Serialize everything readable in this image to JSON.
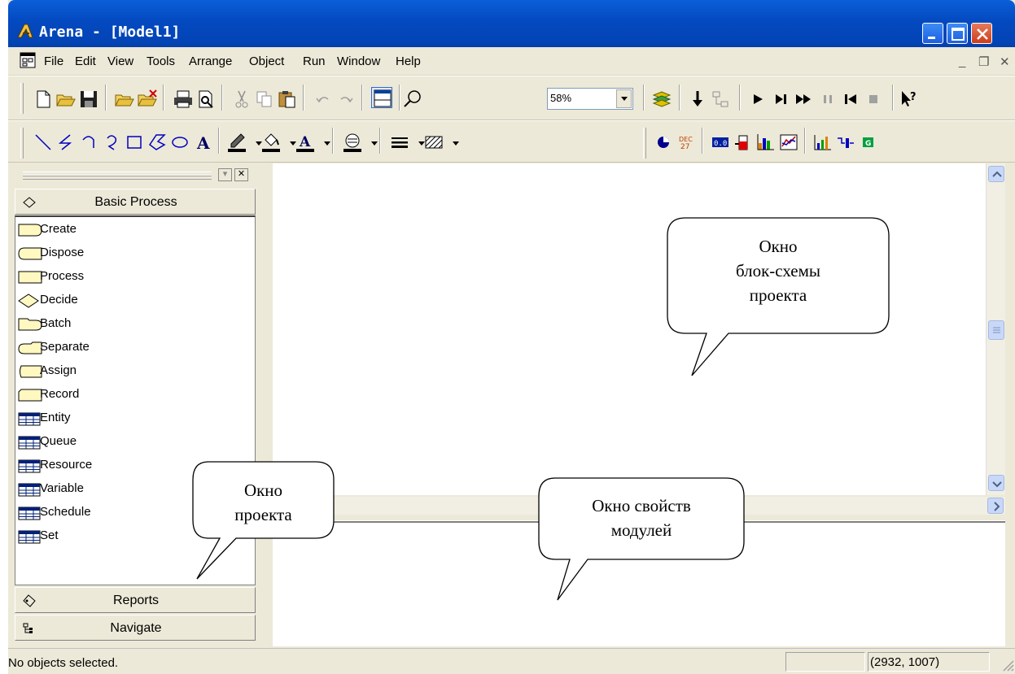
{
  "window": {
    "title": "Arena - [Model1]"
  },
  "menu": {
    "items": [
      "File",
      "Edit",
      "View",
      "Tools",
      "Arrange",
      "Object",
      "Run",
      "Window",
      "Help"
    ],
    "mdi_minimize": "_",
    "mdi_restore": "❐",
    "mdi_close": "✕"
  },
  "toolbar": {
    "zoom_value": "58%"
  },
  "project_bar": {
    "panels": [
      "Basic Process",
      "Reports",
      "Navigate"
    ],
    "modules": [
      {
        "label": "Create",
        "shape": "create"
      },
      {
        "label": "Dispose",
        "shape": "dispose"
      },
      {
        "label": "Process",
        "shape": "process"
      },
      {
        "label": "Decide",
        "shape": "decide"
      },
      {
        "label": "Batch",
        "shape": "batch"
      },
      {
        "label": "Separate",
        "shape": "separate"
      },
      {
        "label": "Assign",
        "shape": "assign"
      },
      {
        "label": "Record",
        "shape": "record"
      },
      {
        "label": "Entity",
        "shape": "table"
      },
      {
        "label": "Queue",
        "shape": "table"
      },
      {
        "label": "Resource",
        "shape": "table"
      },
      {
        "label": "Variable",
        "shape": "table"
      },
      {
        "label": "Schedule",
        "shape": "table"
      },
      {
        "label": "Set",
        "shape": "table"
      }
    ]
  },
  "status_bar": {
    "message": "No objects selected.",
    "coordinates": "(2932, 1007)"
  },
  "callouts": {
    "flowchart": [
      "Окно",
      "блок-схемы",
      "проекта"
    ],
    "project": [
      "Окно",
      "проекта"
    ],
    "properties": [
      "Окно свойств",
      "модулей"
    ]
  },
  "colors": {
    "titlebar": "#0449c0",
    "module_fill": "#fff8c0",
    "chrome": "#ece9d8"
  }
}
